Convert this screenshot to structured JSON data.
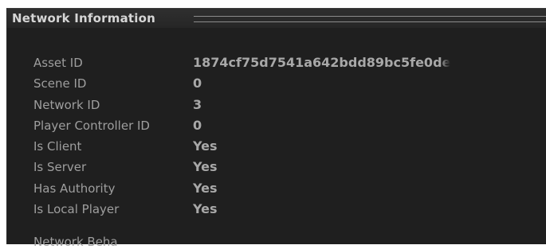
{
  "panel": {
    "title": "Network Information"
  },
  "rows": [
    {
      "label": "Asset ID",
      "value": "1874cf75d7541a642bdd89bc5fe0de"
    },
    {
      "label": "Scene ID",
      "value": "0"
    },
    {
      "label": "Network ID",
      "value": "3"
    },
    {
      "label": "Player Controller ID",
      "value": "0"
    },
    {
      "label": "Is Client",
      "value": "Yes"
    },
    {
      "label": "Is Server",
      "value": "Yes"
    },
    {
      "label": "Has Authority",
      "value": "Yes"
    },
    {
      "label": "Is Local Player",
      "value": "Yes"
    }
  ],
  "footer": {
    "label": "Network Beha"
  },
  "colors": {
    "background": "#1f1f1f",
    "header": "#2b2b2b",
    "label_text": "#9e9e9e",
    "value_text": "#a8a8a8"
  }
}
